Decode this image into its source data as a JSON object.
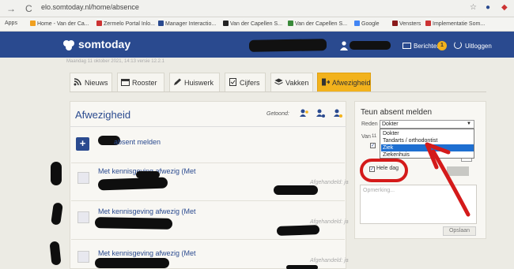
{
  "browser": {
    "address": "elo.somtoday.nl/home/absence",
    "bookmarks": [
      {
        "label": "Apps",
        "color": "#888"
      },
      {
        "label": "Home - Van der Ca...",
        "color": "#f0a020"
      },
      {
        "label": "Zermelo Portal Inlo...",
        "color": "#c33"
      },
      {
        "label": "Manager Interactio...",
        "color": "#2a4a8f"
      },
      {
        "label": "Van der Capellen S...",
        "color": "#222"
      },
      {
        "label": "Van der Capellen S...",
        "color": "#3a8a3a"
      },
      {
        "label": "Google",
        "color": "#4285f4"
      },
      {
        "label": "Vensters",
        "color": "#8a1a1a"
      },
      {
        "label": "Implementatie Som...",
        "color": "#c33"
      }
    ]
  },
  "header": {
    "logo": "somtoday",
    "messages_label": "Berichten",
    "messages_count": "1",
    "logout_label": "Uitloggen",
    "date_line": "Maandag 11 oktober 2021, 14:13 versie 12.2.1"
  },
  "tabs": [
    {
      "label": "Nieuws",
      "icon": "rss-icon",
      "active": false
    },
    {
      "label": "Rooster",
      "icon": "calendar-icon",
      "active": false
    },
    {
      "label": "Huiswerk",
      "icon": "pencil-icon",
      "active": false
    },
    {
      "label": "Cijfers",
      "icon": "grades-icon",
      "active": false
    },
    {
      "label": "Vakken",
      "icon": "books-icon",
      "active": false
    },
    {
      "label": "Afwezigheid",
      "icon": "absence-icon",
      "active": true
    }
  ],
  "main": {
    "title": "Afwezigheid",
    "filter_label": "Getoond:",
    "add_label": "absent melden",
    "rows": [
      {
        "title": "Met kennisgeving afwezig (Met",
        "status": "Afgehandeld: ja"
      },
      {
        "title": "Met kennisgeving afwezig (Met",
        "status": "Afgehandeld: ja"
      },
      {
        "title": "Met kennisgeving afwezig (Met",
        "status": "Afgehandeld: ja"
      }
    ]
  },
  "side": {
    "title": "Teun absent melden",
    "reden_label": "Reden",
    "selected": "Dokter",
    "options": [
      "Dokter",
      "Tandarts / orthodontist",
      "Ziek",
      "Ziekenhuis"
    ],
    "highlighted_option": "Ziek",
    "van_label": "Van",
    "van_fragment": "11",
    "hele_dag_label": "Hele dag",
    "hele_dag_checked": true,
    "remark_placeholder": "Opmerking...",
    "save_label": "Opslaan"
  },
  "colors": {
    "brand": "#2a4a8f",
    "active_tab": "#f2b21c",
    "annotation": "#d41a1a",
    "selection": "#1e6fd1"
  }
}
